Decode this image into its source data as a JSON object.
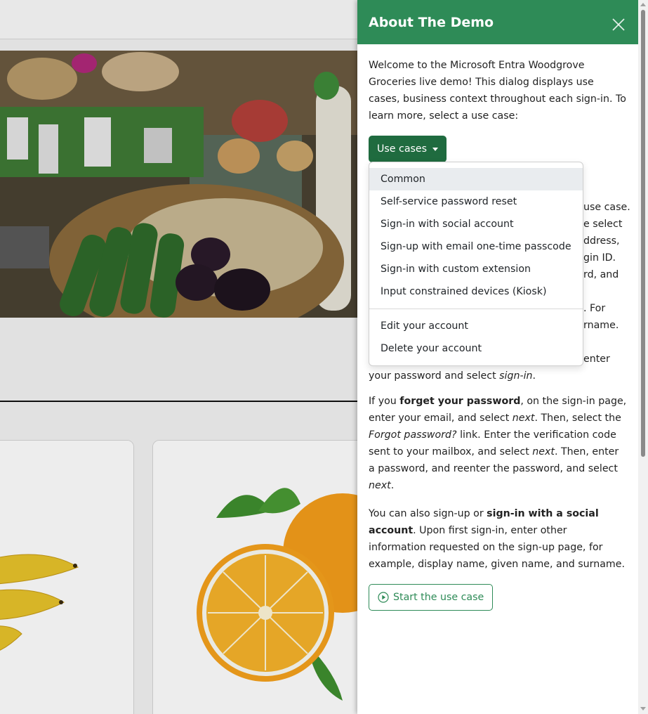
{
  "panel": {
    "title": "About The Demo",
    "intro": "Welcome to the Microsoft Entra Woodgrove Groceries live demo! This dialog displays use cases, business context throughout each sign-in. To learn more, select a use case:",
    "dropdown_label": "Use cases",
    "hidden_fragments": [
      "use case.",
      "e select",
      "ddress,",
      "gin ID.",
      "rd, and",
      ". For",
      "rname.",
      "enter"
    ],
    "para_password_end_1": "your password and select ",
    "para_password_end_em": "sign-in",
    "para_password_end_2": ".",
    "forgot": {
      "t1": "If you ",
      "b1": "forget your password",
      "t2": ", on the sign-in page, enter your email, and select ",
      "e1": "next",
      "t3": ". Then, select the ",
      "e2": "Forgot password?",
      "t4": " link. Enter the verification code sent to your mailbox, and select ",
      "e3": "next",
      "t5": ". Then, enter a password, and reenter the password, and select ",
      "e4": "next",
      "t6": "."
    },
    "social": {
      "t1": "You can also sign-up or ",
      "b1": "sign-in with a social account",
      "t2": ". Upon first sign-in, enter other information requested on the sign-up page, for example, display name, given name, and surname."
    },
    "start_button": "Start the use case"
  },
  "dropdown": {
    "items": [
      {
        "label": "Common",
        "active": true
      },
      {
        "label": "Self-service password reset"
      },
      {
        "label": "Sign-in with social account"
      },
      {
        "label": "Sign-up with email one-time passcode"
      },
      {
        "label": "Sign-in with custom extension"
      },
      {
        "label": "Input constrained devices (Kiosk)"
      }
    ],
    "account_items": [
      {
        "label": "Edit your account"
      },
      {
        "label": "Delete your account"
      }
    ]
  },
  "colors": {
    "brand_green": "#2e8b57",
    "button_dark_green": "#1f6b3f"
  },
  "icons": {
    "close": "close-icon",
    "caret": "caret-down-icon",
    "play": "play-circle-icon"
  }
}
